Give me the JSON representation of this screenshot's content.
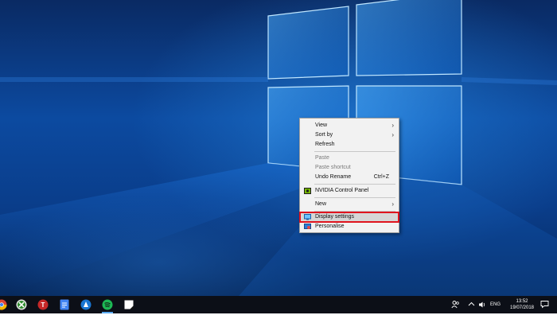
{
  "context_menu": {
    "items": [
      {
        "label": "View"
      },
      {
        "label": "Sort by"
      },
      {
        "label": "Refresh"
      },
      {
        "label": "Paste"
      },
      {
        "label": "Paste shortcut"
      },
      {
        "label": "Undo Rename",
        "shortcut": "Ctrl+Z"
      },
      {
        "label": "NVIDIA Control Panel"
      },
      {
        "label": "New"
      },
      {
        "label": "Display settings"
      },
      {
        "label": "Personalise"
      }
    ],
    "highlight_color": "#e0141e"
  },
  "taskbar": {
    "apps": [
      "chrome-icon",
      "xbox-icon",
      "t-app-icon",
      "docs-icon",
      "browser-icon",
      "spotify-icon",
      "sticky-notes-icon"
    ],
    "tray": {
      "language": "ENG"
    },
    "clock": {
      "time": "13:52",
      "date": "19/07/2018"
    }
  }
}
